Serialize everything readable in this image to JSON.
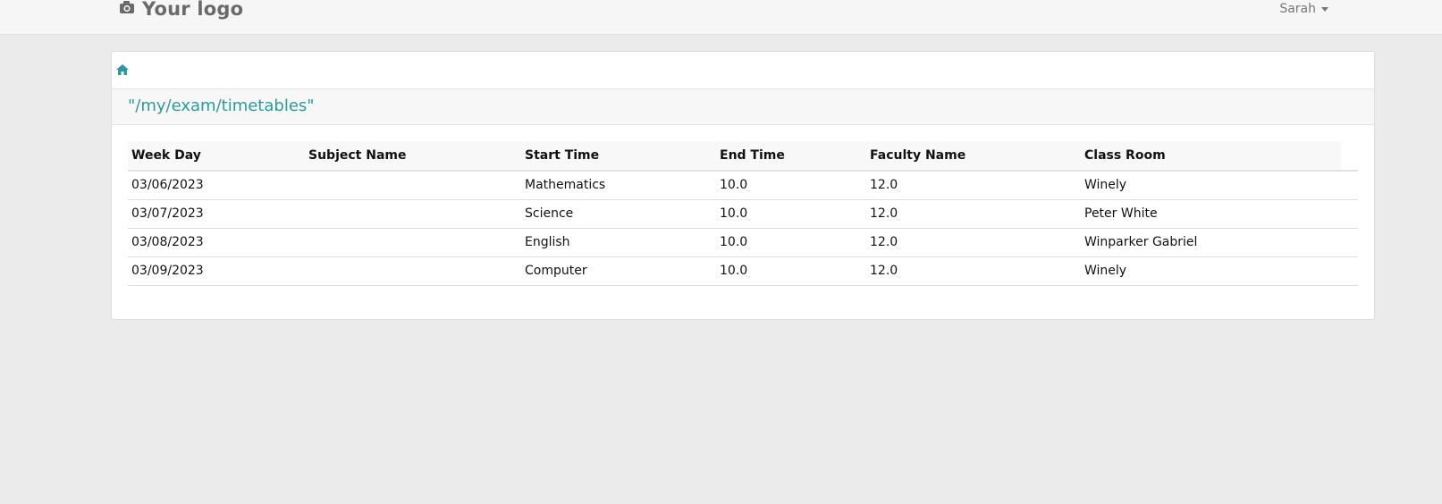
{
  "header": {
    "logo_text": "Your logo",
    "logo_icon": "camera-icon",
    "user_name": "Sarah"
  },
  "breadcrumb": {
    "home_icon": "home-icon"
  },
  "page": {
    "title": "\"/my/exam/timetables\""
  },
  "table": {
    "columns": [
      "Week Day",
      "Subject Name",
      "Start Time",
      "End Time",
      "Faculty Name",
      "Class Room"
    ],
    "rows": [
      [
        "03/06/2023",
        "",
        "Mathematics",
        "10.0",
        "12.0",
        "Winely"
      ],
      [
        "03/07/2023",
        "",
        "Science",
        "10.0",
        "12.0",
        "Peter White"
      ],
      [
        "03/08/2023",
        "",
        "English",
        "10.0",
        "12.0",
        "Winparker Gabriel"
      ],
      [
        "03/09/2023",
        "",
        "Computer",
        "10.0",
        "12.0",
        "Winely"
      ]
    ]
  },
  "colors": {
    "accent": "#2b9aa0",
    "page_background": "#ebebeb",
    "header_background": "#f6f6f6"
  }
}
